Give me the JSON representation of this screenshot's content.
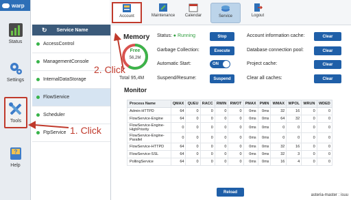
{
  "app": {
    "logo_text": "warp"
  },
  "sidebar": {
    "items": [
      {
        "label": "Status",
        "icon": "status-chart-icon"
      },
      {
        "label": "Settings",
        "icon": "settings-gears-icon"
      },
      {
        "label": "Tools",
        "icon": "tools-wrench-icon"
      },
      {
        "label": "Help",
        "icon": "help-question-icon"
      }
    ]
  },
  "toolbar": {
    "items": [
      {
        "label": "Account",
        "icon": "account-icon"
      },
      {
        "label": "Maintenance",
        "icon": "maintenance-icon"
      },
      {
        "label": "Calendar",
        "icon": "calendar-icon"
      },
      {
        "label": "Service",
        "icon": "service-icon"
      },
      {
        "label": "Logout",
        "icon": "logout-icon"
      }
    ]
  },
  "service_panel": {
    "header": "Service Name",
    "items": [
      "AccessControl",
      "ManagementConsole",
      "InternalDataStorage",
      "FlowService",
      "Scheduler",
      "FtpService"
    ],
    "selected": "FlowService",
    "status_color": "#38b44a"
  },
  "memory": {
    "title": "Memory",
    "free_label": "Free",
    "free_value": "56,2M",
    "total_label": "Total 95,4M",
    "free_fraction": 0.59
  },
  "controls": {
    "status_label": "Status:",
    "status_value": "Running",
    "stop_label": "Stop",
    "gc_label": "Garbage Collection:",
    "execute_label": "Execute",
    "auto_start_label": "Automatic Start:",
    "auto_start_value": "ON",
    "suspend_label": "Suspend/Resume:",
    "suspend_btn": "Suspend",
    "account_cache_label": "Account information cache:",
    "db_pool_label": "Database connection pool:",
    "project_cache_label": "Project cache:",
    "all_caches_label": "Clear all caches:",
    "clear_label": "Clear"
  },
  "monitor": {
    "title": "Monitor",
    "columns": [
      "Process Name",
      "QMAX",
      "QUEU",
      "RACC",
      "RWIN",
      "RWOT",
      "PMAX",
      "PMIN",
      "WMAX",
      "WPOL",
      "WRUN",
      "WDED"
    ],
    "rows": [
      [
        "Admin-HTTPD",
        "64",
        "0",
        "0",
        "0",
        "0",
        "0ms",
        "0ms",
        "32",
        "16",
        "0",
        "0"
      ],
      [
        "FlowService-Engine",
        "64",
        "0",
        "0",
        "0",
        "0",
        "0ms",
        "0ms",
        "64",
        "32",
        "0",
        "0"
      ],
      [
        "FlowService-Engine-\nHighPriority",
        "0",
        "0",
        "0",
        "0",
        "0",
        "0ms",
        "0ms",
        "0",
        "0",
        "0",
        "0"
      ],
      [
        "FlowService-Engine-\nParallel",
        "0",
        "0",
        "0",
        "0",
        "0",
        "0ms",
        "0ms",
        "0",
        "0",
        "0",
        "0"
      ],
      [
        "FlowService-HTTPD",
        "64",
        "0",
        "0",
        "0",
        "0",
        "0ms",
        "0ms",
        "32",
        "16",
        "0",
        "0"
      ],
      [
        "FlowService-SSL",
        "64",
        "0",
        "0",
        "0",
        "0",
        "0ms",
        "0ms",
        "32",
        "3",
        "0",
        "0"
      ],
      [
        "PollingService",
        "64",
        "0",
        "0",
        "0",
        "0",
        "0ms",
        "0ms",
        "16",
        "4",
        "0",
        "0"
      ]
    ],
    "reload_label": "Reload"
  },
  "footer": {
    "text": "asteria-master : isuu"
  },
  "annotations": {
    "click1": "1. Click",
    "click2": "2. Click",
    "color": "#c0392b"
  },
  "colors": {
    "accent": "#1f5fa8",
    "running": "#2f9e3e",
    "header": "#3b5a7a"
  }
}
